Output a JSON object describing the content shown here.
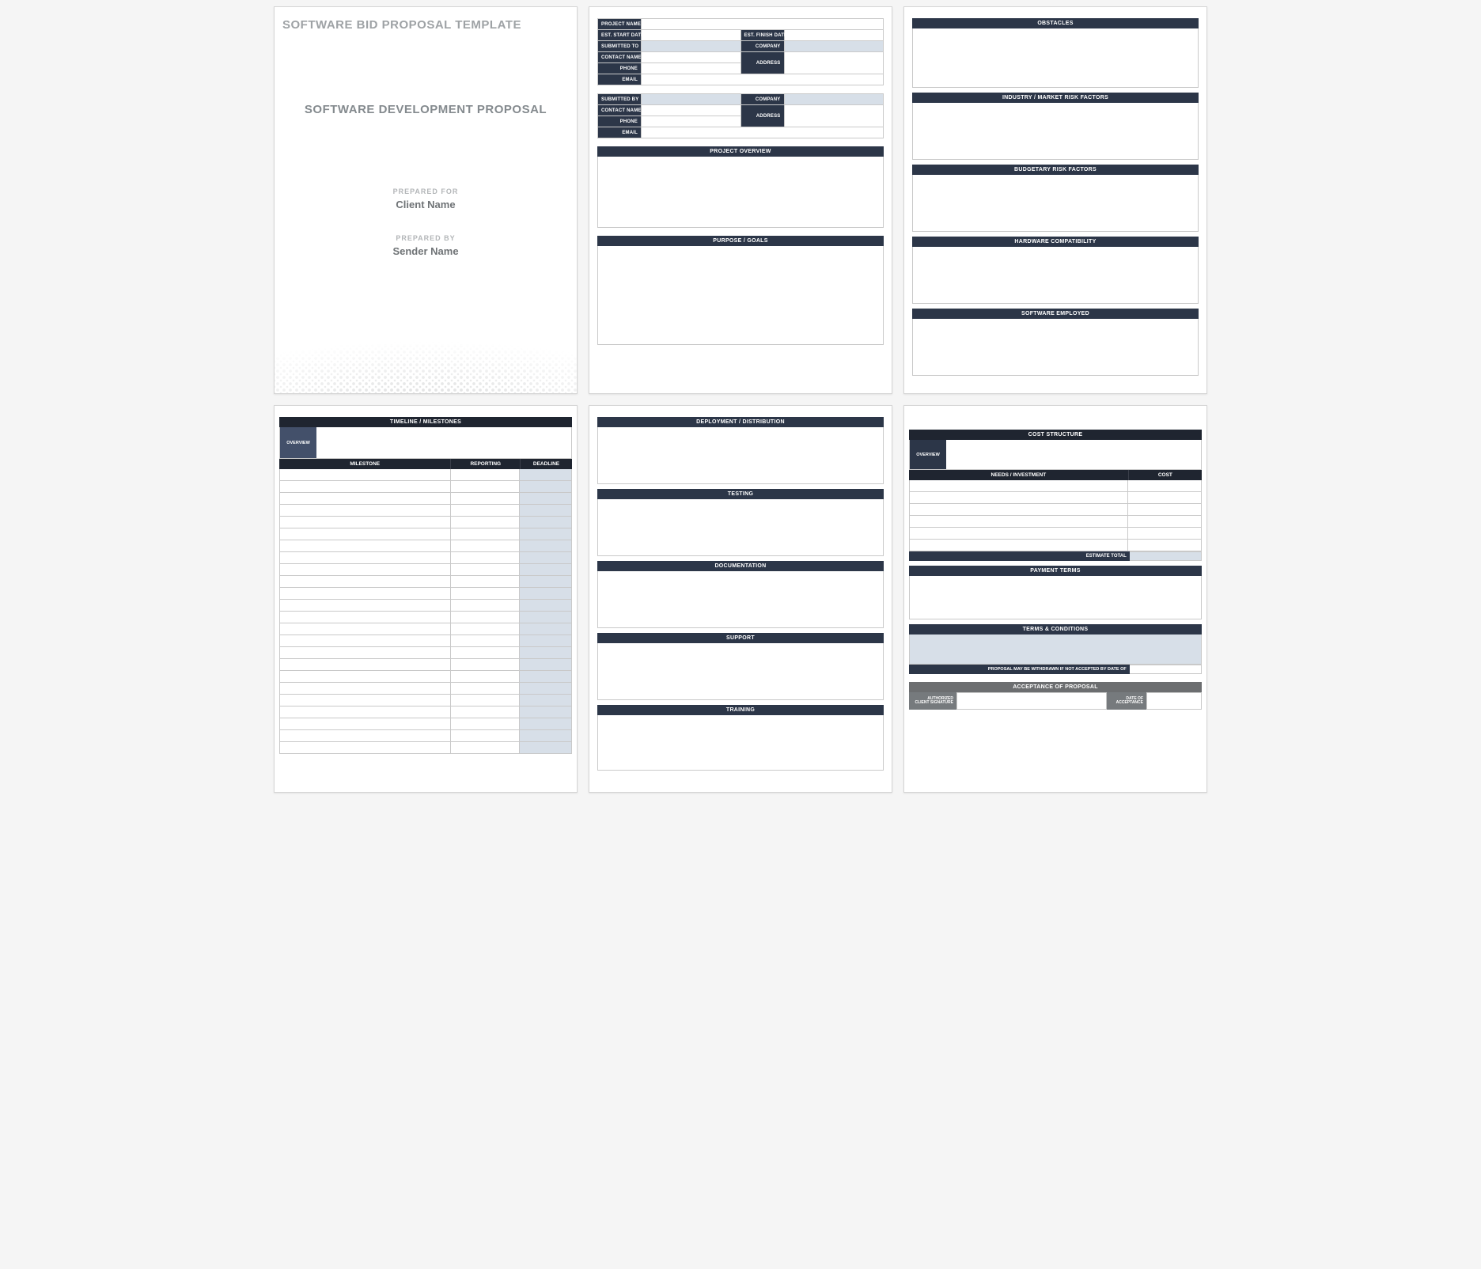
{
  "colors": {
    "navy": "#2c3648",
    "navy_dark": "#1f2530",
    "slate": "#43506a",
    "gray": "#6c6e70",
    "light_blue": "#d7dfe8"
  },
  "page1": {
    "template_title": "SOFTWARE BID PROPOSAL TEMPLATE",
    "proposal_title": "SOFTWARE DEVELOPMENT PROPOSAL",
    "prepared_for_label": "PREPARED FOR",
    "prepared_for_value": "Client Name",
    "prepared_by_label": "PREPARED BY",
    "prepared_by_value": "Sender Name"
  },
  "page2": {
    "block1": {
      "project_name": "PROJECT NAME",
      "est_start_date": "EST. START DATE",
      "est_finish_date": "EST. FINISH DATE",
      "submitted_to": "SUBMITTED TO",
      "company": "COMPANY",
      "contact_name": "CONTACT NAME",
      "address": "ADDRESS",
      "phone": "PHONE",
      "email": "EMAIL"
    },
    "block2": {
      "submitted_by": "SUBMITTED BY",
      "company": "COMPANY",
      "contact_name": "CONTACT NAME",
      "address": "ADDRESS",
      "phone": "PHONE",
      "email": "EMAIL"
    },
    "project_overview": "PROJECT OVERVIEW",
    "purpose_goals": "PURPOSE / GOALS"
  },
  "page3": {
    "obstacles": "OBSTACLES",
    "industry_risk": "INDUSTRY / MARKET RISK FACTORS",
    "budgetary_risk": "BUDGETARY RISK FACTORS",
    "hardware": "HARDWARE COMPATIBILITY",
    "software": "SOFTWARE EMPLOYED"
  },
  "page4": {
    "title": "TIMELINE / MILESTONES",
    "overview": "OVERVIEW",
    "col_milestone": "MILESTONE",
    "col_reporting": "REPORTING",
    "col_deadline": "DEADLINE",
    "row_count": 24
  },
  "page5": {
    "deployment": "DEPLOYMENT / DISTRIBUTION",
    "testing": "TESTING",
    "documentation": "DOCUMENTATION",
    "support": "SUPPORT",
    "training": "TRAINING"
  },
  "page6": {
    "cost_structure": "COST STRUCTURE",
    "overview": "OVERVIEW",
    "col_needs": "NEEDS / INVESTMENT",
    "col_cost": "COST",
    "cost_row_count": 6,
    "estimate_total": "ESTIMATE TOTAL",
    "payment_terms": "PAYMENT TERMS",
    "terms_conditions": "TERMS & CONDITIONS",
    "withdraw": "PROPOSAL MAY BE WITHDRAWN IF NOT ACCEPTED BY DATE OF",
    "acceptance": "ACCEPTANCE OF PROPOSAL",
    "auth_sig": "AUTHORIZED\nCLIENT SIGNATURE",
    "date_accept": "DATE OF\nACCEPTANCE"
  }
}
